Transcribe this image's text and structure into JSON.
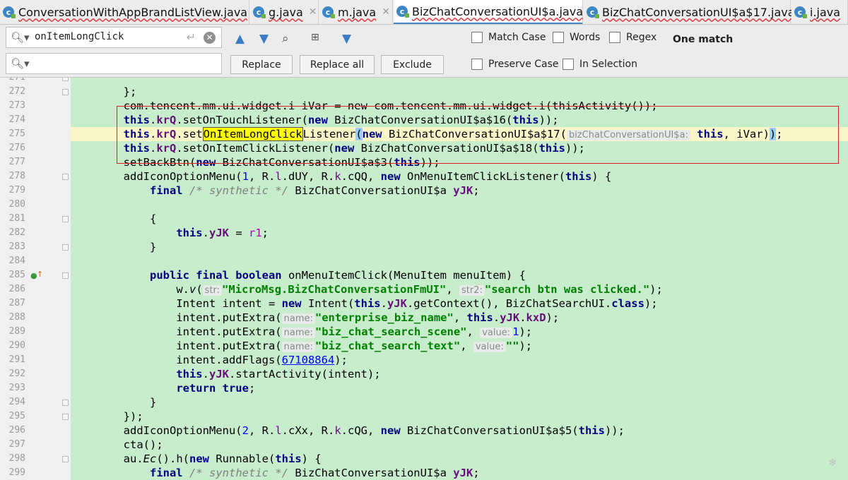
{
  "tabs": [
    {
      "label": "ConversationWithAppBrandListView.java",
      "icon": "java-class-icon",
      "active": false
    },
    {
      "label": "g.java",
      "icon": "java-class-icon",
      "active": false
    },
    {
      "label": "m.java",
      "icon": "java-class-icon",
      "active": false
    },
    {
      "label": "BizChatConversationUI$a.java",
      "icon": "java-class-icon",
      "active": true
    },
    {
      "label": "BizChatConversationUI$a$17.java",
      "icon": "java-class-icon",
      "active": false
    },
    {
      "label": "i.java",
      "icon": "java-class-icon",
      "active": false
    }
  ],
  "find": {
    "search_value": "onItemLongClick",
    "replace_value": "",
    "match_count": "One match",
    "buttons": {
      "replace": "Replace",
      "replace_all": "Replace all",
      "exclude": "Exclude"
    },
    "options": {
      "match_case": "Match Case",
      "words": "Words",
      "regex": "Regex",
      "preserve_case": "Preserve Case",
      "in_selection": "In Selection"
    }
  },
  "editor": {
    "current_line": 275,
    "lines": [
      {
        "n": "271"
      },
      {
        "n": "272"
      },
      {
        "n": "273"
      },
      {
        "n": "274"
      },
      {
        "n": "275"
      },
      {
        "n": "276"
      },
      {
        "n": "277"
      },
      {
        "n": "278"
      },
      {
        "n": "279"
      },
      {
        "n": "280"
      },
      {
        "n": "281"
      },
      {
        "n": "282"
      },
      {
        "n": "283"
      },
      {
        "n": "284"
      },
      {
        "n": "285"
      },
      {
        "n": "286"
      },
      {
        "n": "287"
      },
      {
        "n": "288"
      },
      {
        "n": "289"
      },
      {
        "n": "290"
      },
      {
        "n": "291"
      },
      {
        "n": "292"
      },
      {
        "n": "293"
      },
      {
        "n": "294"
      },
      {
        "n": "295"
      },
      {
        "n": "296"
      },
      {
        "n": "297"
      },
      {
        "n": "298"
      },
      {
        "n": "299"
      }
    ],
    "code": {
      "l272": "};",
      "l273": "com.tencent.mm.ui.widget.i iVar = new com.tencent.mm.ui.widget.i(thisActivity());",
      "l274_kw": "this",
      "l274_fld": "krQ",
      "l274_rest": ".setOnTouchListener(",
      "l274_new": "new",
      "l274_cls": " BizChatConversationUI$a$16(",
      "l274_end": "));",
      "l275_kw": "this",
      "l275_fld": "krQ",
      "l275_pre": ".set",
      "l275_match": "OnItemLongClick",
      "l275_post": "Listener",
      "l275_paren": "(",
      "l275_new": "new",
      "l275_cls": " BizChatConversationUI$a$17(",
      "l275_hint": "bizChatConversationUI$a:",
      "l275_this": "this",
      "l275_ivar": ", iVar)",
      "l275_brace": ")",
      "l275_end": ";",
      "l276_kw": "this",
      "l276_fld": "krQ",
      "l276_rest": ".setOnItemClickListener(",
      "l276_new": "new",
      "l276_cls": " BizChatConversationUI$a$18(",
      "l276_end": "));",
      "l277_pre": "setBackBtn(",
      "l277_new": "new",
      "l277_cls": " BizChatConversationUI$a$3(",
      "l277_end": "));",
      "l278_pre": "addIconOptionMenu(",
      "l278_num": "1",
      "l278_mid": ", R.",
      "l278_f1": "l",
      "l278_mid2": ".dUY, R.",
      "l278_f2": "k",
      "l278_mid3": ".cQQ, ",
      "l278_new": "new",
      "l278_cls": " OnMenuItemClickListener(",
      "l278_end": ") {",
      "l279_final": "final",
      "l279_cmt": "/* synthetic */",
      "l279_cls": " BizChatConversationUI$a ",
      "l279_fld": "yJK",
      "l279_end": ";",
      "l281": "{",
      "l282_kw": "this",
      "l282_dot": ".",
      "l282_fld": "yJK",
      "l282_eq": " = ",
      "l282_r1": "r1",
      "l282_end": ";",
      "l283": "}",
      "l285_kw": "public final boolean",
      "l285_rest": " onMenuItemClick(MenuItem menuItem) {",
      "l286_pre": "w.",
      "l286_v": "v",
      "l286_p": "(",
      "l286_hint1": "str:",
      "l286_s1": "\"MicroMsg.BizChatConversationFmUI\"",
      "l286_comma": ", ",
      "l286_hint2": "str2:",
      "l286_s2": "\"search btn was clicked.\"",
      "l286_end": ");",
      "l287_pre": "Intent intent = ",
      "l287_new": "new",
      "l287_mid": " Intent(",
      "l287_kw": "this",
      "l287_dot": ".",
      "l287_fld": "yJK",
      "l287_mid2": ".getContext(), BizChatSearchUI.",
      "l287_class": "class",
      "l287_end": ");",
      "l288_pre": "intent.putExtra(",
      "l288_hint": "name:",
      "l288_str": "\"enterprise_biz_name\"",
      "l288_comma": ", ",
      "l288_kw": "this",
      "l288_dot": ".",
      "l288_fld": "yJK",
      "l288_dot2": ".",
      "l288_fld2": "kxD",
      "l288_end": ");",
      "l289_pre": "intent.putExtra(",
      "l289_hint": "name:",
      "l289_str": "\"biz_chat_search_scene\"",
      "l289_comma": ", ",
      "l289_hint2": "value:",
      "l289_num": "1",
      "l289_end": ");",
      "l290_pre": "intent.putExtra(",
      "l290_hint": "name:",
      "l290_str": "\"biz_chat_search_text\"",
      "l290_comma": ", ",
      "l290_hint2": "value:",
      "l290_str2": "\"\"",
      "l290_end": ");",
      "l291_pre": "intent.addFlags(",
      "l291_num": "67108864",
      "l291_end": ");",
      "l292_kw": "this",
      "l292_dot": ".",
      "l292_fld": "yJK",
      "l292_end": ".startActivity(intent);",
      "l293_kw": "return true",
      "l293_end": ";",
      "l294": "}",
      "l295": "});",
      "l296_pre": "addIconOptionMenu(",
      "l296_num": "2",
      "l296_mid": ", R.",
      "l296_f1": "l",
      "l296_mid2": ".cXx, R.",
      "l296_f2": "k",
      "l296_mid3": ".cQG, ",
      "l296_new": "new",
      "l296_cls": " BizChatConversationUI$a$5(",
      "l296_kw": "this",
      "l296_end": "));",
      "l297": "cta();",
      "l298_pre": "au.",
      "l298_ec": "Ec",
      "l298_mid": "().h(",
      "l298_new": "new",
      "l298_cls": " Runnable(",
      "l298_kw": "this",
      "l298_end": ") {",
      "l299_final": "final",
      "l299_cmt": "/* synthetic */",
      "l299_cls": " BizChatConversationUI$a ",
      "l299_fld": "yJK",
      "l299_end": ";"
    }
  },
  "colors": {
    "accent": "#4a88c7",
    "highlight": "#ffff00",
    "editor_bg": "#c7edcc",
    "red_box": "#e02020"
  }
}
